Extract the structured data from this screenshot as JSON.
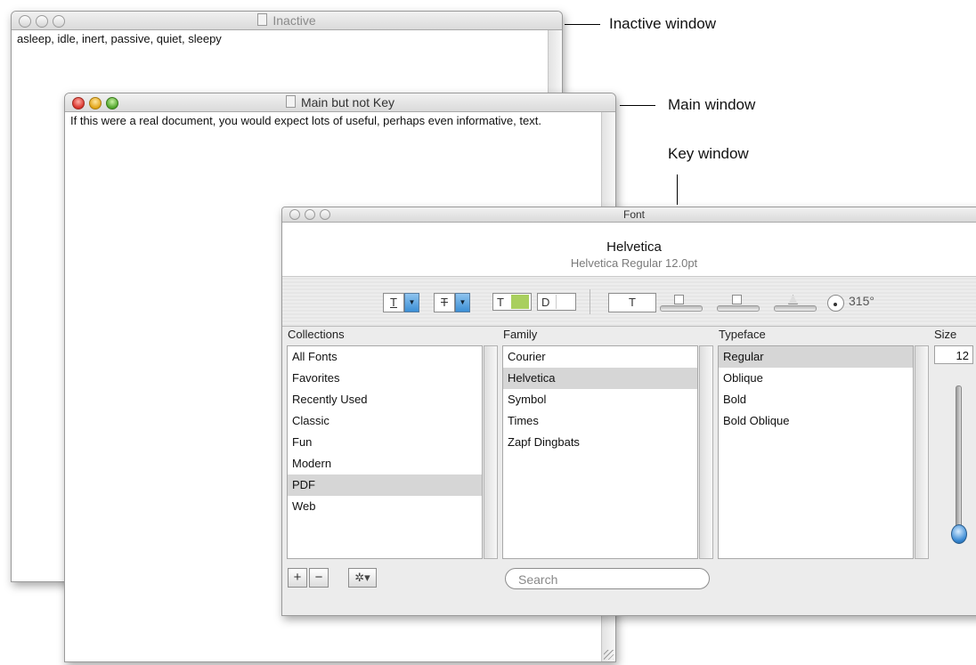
{
  "inactive_window": {
    "title": "Inactive",
    "text": "asleep, idle, inert, passive, quiet, sleepy"
  },
  "main_window": {
    "title": "Main but not Key",
    "text": "If this were a real document, you would expect lots of useful, perhaps even informative, text."
  },
  "callouts": {
    "inactive": "Inactive window",
    "main": "Main window",
    "key": "Key window"
  },
  "font_panel": {
    "title": "Font",
    "font_name": "Helvetica",
    "font_description": "Helvetica Regular 12.0pt",
    "toolbar": {
      "underline_glyph": "T",
      "strikethrough_glyph": "T",
      "text_color_glyph": "T",
      "text_color": "#a9cf5e",
      "document_glyph": "D",
      "shadow_glyph": "T",
      "rotation_value": "315°"
    },
    "headers": {
      "collections": "Collections",
      "family": "Family",
      "typeface": "Typeface",
      "size": "Size"
    },
    "collections": [
      "All Fonts",
      "Favorites",
      "Recently Used",
      "Classic",
      "Fun",
      "Modern",
      "PDF",
      "Web"
    ],
    "collections_selected": "PDF",
    "families": [
      "Courier",
      "Helvetica",
      "Symbol",
      "Times",
      "Zapf Dingbats"
    ],
    "families_selected": "Helvetica",
    "typefaces": [
      "Regular",
      "Oblique",
      "Bold",
      "Bold Oblique"
    ],
    "typefaces_selected": "Regular",
    "size_value": "12",
    "buttons": {
      "add": "+",
      "remove": "−",
      "action": "✲▾"
    },
    "search_placeholder": "Search"
  },
  "icons": {
    "doc": "document-icon",
    "gear": "gear-icon",
    "rotation": "rotation-dial-icon"
  }
}
